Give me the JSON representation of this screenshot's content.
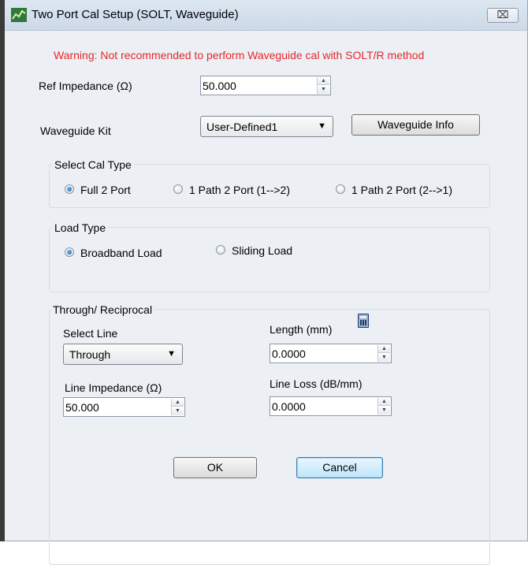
{
  "window": {
    "title": "Two Port Cal Setup (SOLT, Waveguide)",
    "close_glyph": "⌧"
  },
  "warning": "Warning:  Not recommended to perform Waveguide cal with SOLT/R method",
  "ref_impedance": {
    "label": "Ref Impedance (Ω)",
    "value": "50.000"
  },
  "waveguide_kit": {
    "label": "Waveguide  Kit",
    "selected": "User-Defined1",
    "info_button": "Waveguide Info"
  },
  "cal_type": {
    "title": "Select Cal Type",
    "options": [
      "Full 2 Port",
      "1 Path 2 Port (1-->2)",
      "1 Path 2 Port (2-->1)"
    ],
    "selected_index": 0
  },
  "load_type": {
    "title": "Load Type",
    "options": [
      "Broadband Load",
      "Sliding Load"
    ],
    "selected_index": 0
  },
  "through": {
    "title": "Through/ Reciprocal",
    "select_line_label": "Select Line",
    "select_line_value": "Through",
    "length_label": "Length (mm)",
    "length_value": "0.0000",
    "line_impedance_label": "Line Impedance (Ω)",
    "line_impedance_value": "50.000",
    "line_loss_label": "Line Loss (dB/mm)",
    "line_loss_value": "0.0000"
  },
  "buttons": {
    "ok": "OK",
    "cancel": "Cancel"
  },
  "icons": {
    "app": "app-icon",
    "calculator": "calculator-icon",
    "up_arrow": "▲",
    "down_arrow": "▼",
    "combo_arrow": "▼"
  },
  "colors": {
    "warning": "#e8262a",
    "dialog_bg": "#ecf0f5",
    "radio_selected": "#1c5f9c"
  }
}
